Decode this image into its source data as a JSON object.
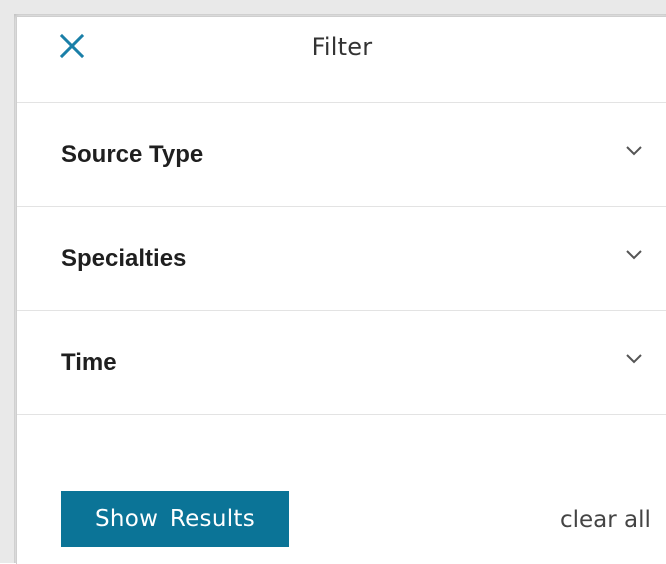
{
  "header": {
    "title": "Filter",
    "close_icon": "close-icon"
  },
  "sections": [
    {
      "label": "Source Type",
      "icon": "chevron-down-icon"
    },
    {
      "label": "Specialties",
      "icon": "chevron-down-icon"
    },
    {
      "label": "Time",
      "icon": "chevron-down-icon"
    }
  ],
  "footer": {
    "show_results_label": "Show  Results",
    "clear_all_label": "clear all"
  },
  "colors": {
    "accent": "#0b7497",
    "close_icon": "#1a7fa8",
    "divider": "#e3e3e3",
    "chevron": "#555555"
  }
}
